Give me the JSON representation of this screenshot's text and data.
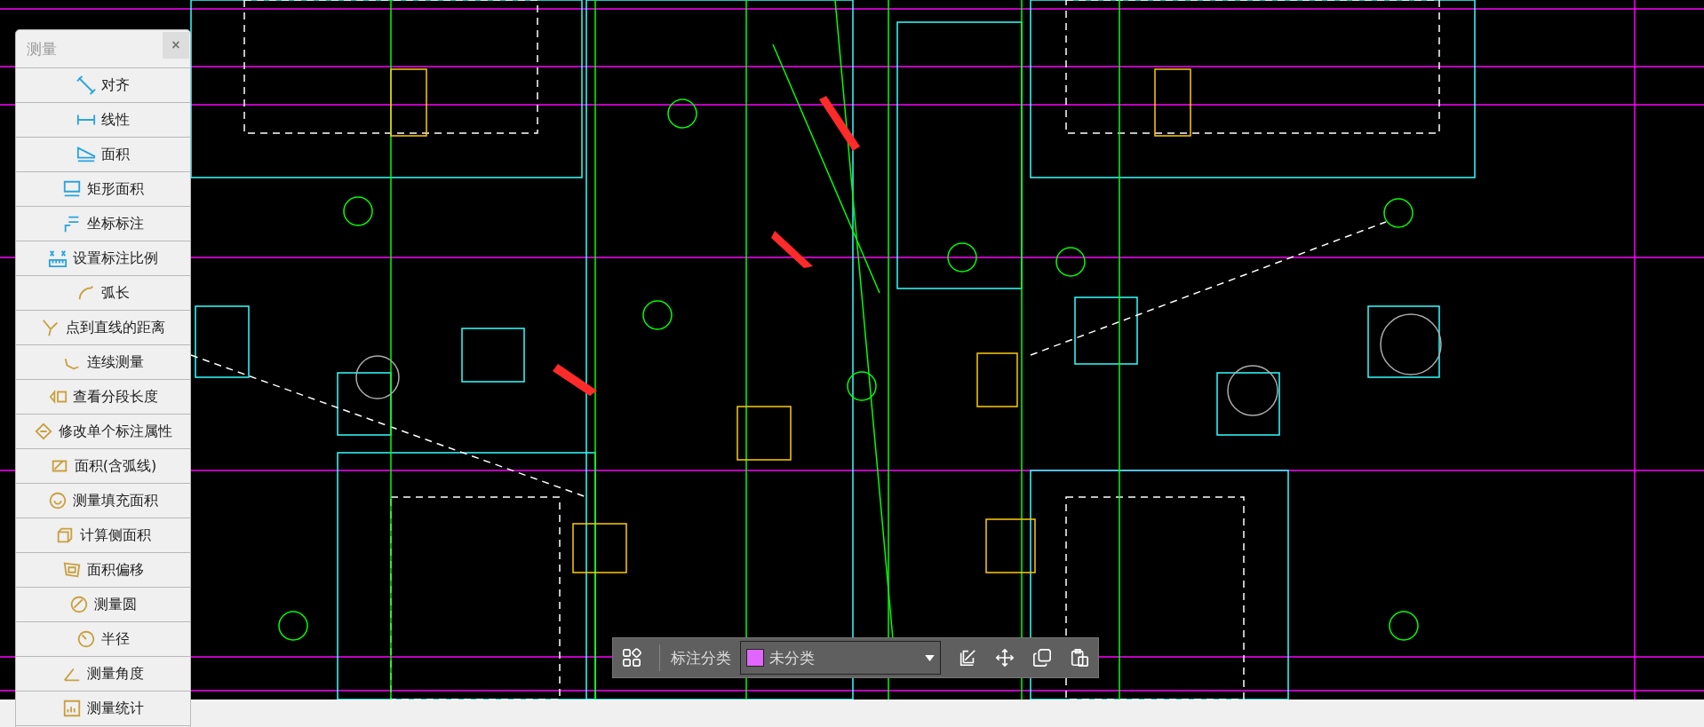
{
  "panel": {
    "title": "测量",
    "close": "×",
    "items": [
      {
        "label": "对齐"
      },
      {
        "label": "线性"
      },
      {
        "label": "面积"
      },
      {
        "label": "矩形面积"
      },
      {
        "label": "坐标标注"
      },
      {
        "label": "设置标注比例"
      },
      {
        "label": "弧长"
      },
      {
        "label": "点到直线的距离"
      },
      {
        "label": "连续测量"
      },
      {
        "label": "查看分段长度"
      },
      {
        "label": "修改单个标注属性"
      },
      {
        "label": "面积(含弧线)"
      },
      {
        "label": "测量填充面积"
      },
      {
        "label": "计算侧面积"
      },
      {
        "label": "面积偏移"
      },
      {
        "label": "测量圆"
      },
      {
        "label": "半径"
      },
      {
        "label": "测量角度"
      },
      {
        "label": "测量统计"
      }
    ]
  },
  "toolbar": {
    "label": "标注分类",
    "category": {
      "value": "未分类",
      "color": "#e066ff"
    }
  }
}
